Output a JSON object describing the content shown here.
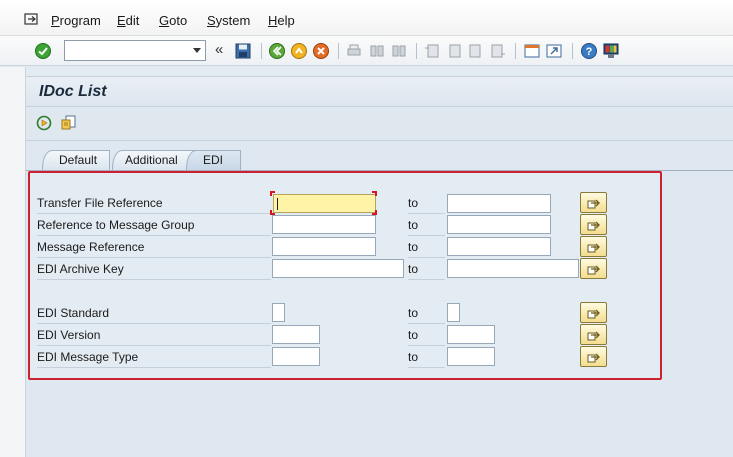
{
  "menubar": {
    "items": [
      {
        "label": "Program"
      },
      {
        "label": "Edit"
      },
      {
        "label": "Goto"
      },
      {
        "label": "System"
      },
      {
        "label": "Help"
      }
    ]
  },
  "toolbar": {
    "command_field_value": "",
    "icons": [
      "enter-check-icon",
      "save-icon",
      "back-icon",
      "exit-icon",
      "cancel-icon",
      "print-icon",
      "find-icon",
      "find-next-icon",
      "first-page-icon",
      "previous-page-icon",
      "next-page-icon",
      "last-page-icon",
      "create-session-icon",
      "shortcut-icon",
      "help-icon",
      "customize-layout-icon"
    ]
  },
  "title": "IDoc List",
  "app_toolbar": {
    "icons": [
      "execute-icon",
      "get-variant-icon"
    ]
  },
  "tabs": [
    {
      "label": "Default",
      "active": false
    },
    {
      "label": "Additional",
      "active": false
    },
    {
      "label": "EDI",
      "active": true
    }
  ],
  "form": {
    "to_label": "to",
    "rows": [
      {
        "label": "Transfer File Reference",
        "from": "",
        "to": ""
      },
      {
        "label": "Reference to Message Group",
        "from": "",
        "to": ""
      },
      {
        "label": "Message Reference",
        "from": "",
        "to": ""
      },
      {
        "label": "EDI Archive Key",
        "from": "",
        "to": ""
      },
      {
        "label": "EDI Standard",
        "from": "",
        "to": ""
      },
      {
        "label": "EDI Version",
        "from": "",
        "to": ""
      },
      {
        "label": "EDI Message Type",
        "from": "",
        "to": ""
      }
    ]
  },
  "colors": {
    "highlight_border": "#cc2230",
    "focused_field": "#fff3a8",
    "background": "#dfe8f0"
  }
}
